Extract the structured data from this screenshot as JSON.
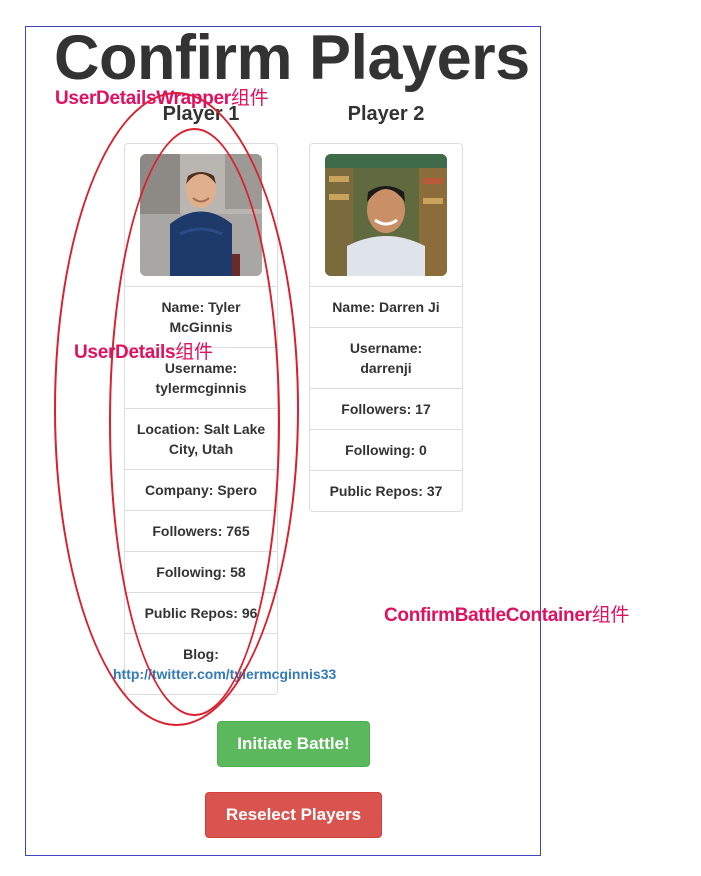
{
  "page": {
    "title": "Confirm Players"
  },
  "players": [
    {
      "heading": "Player 1",
      "name": "Name: Tyler McGinnis",
      "username_label": "Username:",
      "username": "tylermcginnis",
      "location": "Location: Salt Lake City, Utah",
      "company": "Company: Spero",
      "followers": "Followers: 765",
      "following": "Following: 58",
      "public_repos": "Public Repos: 96",
      "blog_label": "Blog:",
      "blog_url": "http://twitter.com/tylermcginnis33"
    },
    {
      "heading": "Player 2",
      "name": "Name: Darren Ji",
      "username_label": "Username:",
      "username": "darrenji",
      "followers": "Followers: 17",
      "following": "Following: 0",
      "public_repos": "Public Repos: 37"
    }
  ],
  "actions": {
    "initiate": "Initiate Battle!",
    "reselect": "Reselect Players"
  },
  "annotations": {
    "wrapper": "UserDetailsWrapper",
    "wrapper_suffix": "组件",
    "details": "UserDetails",
    "details_suffix": "组件",
    "container": "ConfirmBattleContainer",
    "container_suffix": "组件"
  },
  "colors": {
    "container_border": "#3f48b8",
    "annotation": "#e0115f",
    "ellipse": "#d9202c",
    "success": "#5cb85c",
    "danger": "#d9534f",
    "link": "#337ab7"
  }
}
